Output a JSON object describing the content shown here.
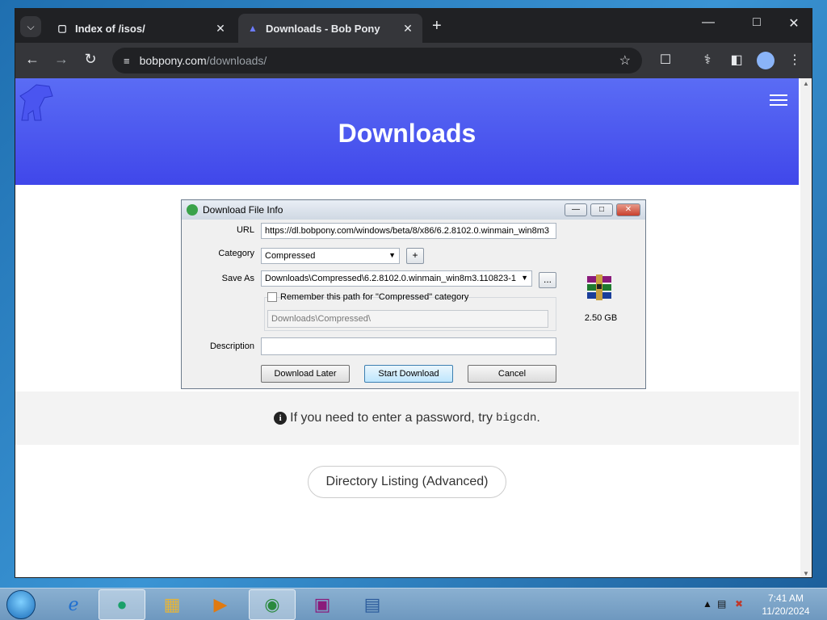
{
  "browser": {
    "tabs": [
      {
        "title": "Index of /isos/",
        "active": false
      },
      {
        "title": "Downloads - Bob Pony",
        "active": true
      }
    ],
    "url_host": "bobpony.com",
    "url_path": "/downloads/"
  },
  "page": {
    "heading": "Downloads",
    "info_text": "If you need to enter a password, try",
    "info_code": "bigcdn",
    "info_end": ".",
    "dir_button": "Directory Listing (Advanced)"
  },
  "dialog": {
    "title": "Download File Info",
    "url_label": "URL",
    "url_value": "https://dl.bobpony.com/windows/beta/8/x86/6.2.8102.0.winmain_win8m3",
    "category_label": "Category",
    "category_value": "Compressed",
    "add_label": "+",
    "saveas_label": "Save As",
    "saveas_value": "Downloads\\Compressed\\6.2.8102.0.winmain_win8m3.110823-1",
    "browse_label": "...",
    "remember_label": "Remember this path for \"Compressed\" category",
    "path_value": "Downloads\\Compressed\\",
    "description_label": "Description",
    "description_value": "",
    "file_size": "2.50  GB",
    "btn_later": "Download Later",
    "btn_start": "Start Download",
    "btn_cancel": "Cancel"
  },
  "taskbar": {
    "time": "7:41 AM",
    "date": "11/20/2024"
  }
}
